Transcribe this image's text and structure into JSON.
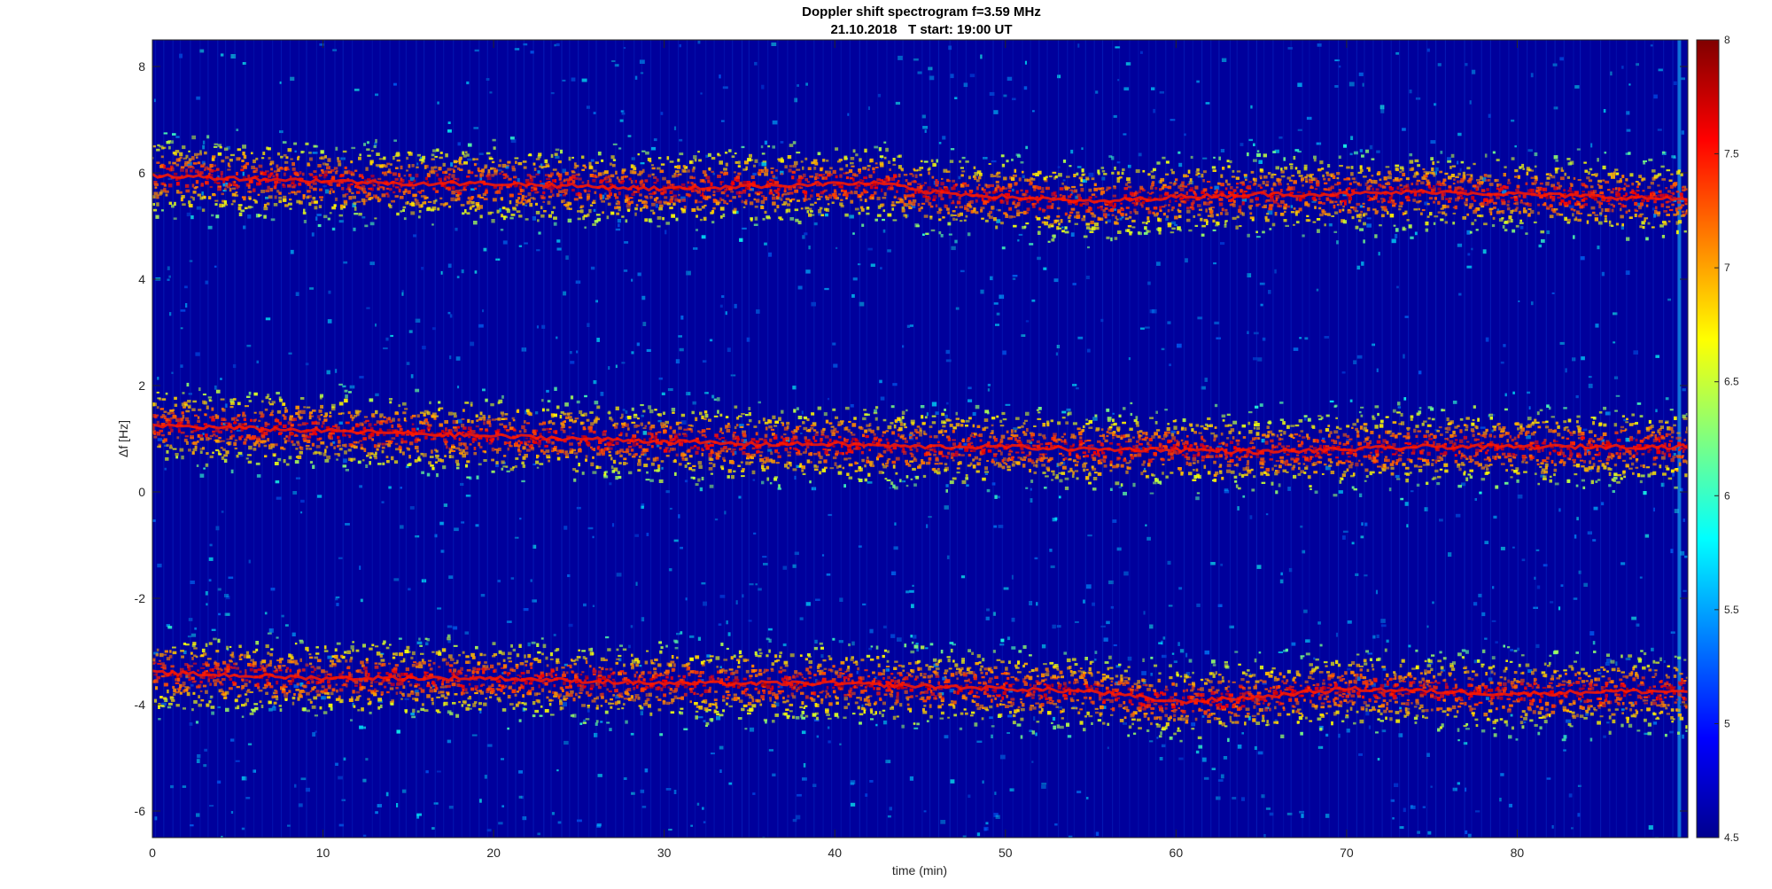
{
  "chart_data": {
    "type": "heatmap",
    "title": "Doppler shift spectrogram f=3.59 MHz",
    "subtitle": "21.10.2018   T start: 19:00 UT",
    "xlabel": "time (min)",
    "ylabel": "Δf [Hz]",
    "xlim": [
      0,
      90
    ],
    "ylim": [
      -6.5,
      8.5
    ],
    "xticks": [
      0,
      10,
      20,
      30,
      40,
      50,
      60,
      70,
      80
    ],
    "yticks": [
      -6,
      -4,
      -2,
      0,
      2,
      4,
      6,
      8
    ],
    "colorbar": {
      "colormap": "jet",
      "range": [
        4.5,
        8
      ],
      "ticks": [
        "4.5",
        "5",
        "5.5",
        "6",
        "6.5",
        "7",
        "7.5",
        "8"
      ]
    },
    "grid": false,
    "series": [
      {
        "x": [
          0,
          5,
          10,
          15,
          20,
          25,
          30,
          35,
          40,
          43,
          45,
          50,
          55,
          60,
          65,
          70,
          75,
          80,
          85,
          90
        ],
        "y": [
          5.95,
          5.9,
          5.85,
          5.8,
          5.8,
          5.75,
          5.7,
          5.75,
          5.8,
          5.8,
          5.65,
          5.55,
          5.45,
          5.55,
          5.6,
          5.6,
          5.65,
          5.6,
          5.55,
          5.5
        ]
      },
      {
        "x": [
          0,
          5,
          10,
          15,
          20,
          25,
          30,
          35,
          40,
          45,
          50,
          55,
          60,
          65,
          70,
          75,
          80,
          85,
          90
        ],
        "y": [
          1.25,
          1.2,
          1.15,
          1.1,
          1.05,
          1.0,
          0.95,
          0.9,
          0.9,
          0.85,
          0.85,
          0.8,
          0.8,
          0.75,
          0.8,
          0.85,
          0.85,
          0.85,
          0.85
        ]
      },
      {
        "x": [
          0,
          5,
          10,
          15,
          20,
          25,
          30,
          35,
          40,
          45,
          50,
          55,
          60,
          65,
          70,
          75,
          80,
          85,
          90
        ],
        "y": [
          -3.4,
          -3.45,
          -3.5,
          -3.5,
          -3.5,
          -3.55,
          -3.6,
          -3.6,
          -3.6,
          -3.65,
          -3.7,
          -3.75,
          -3.95,
          -3.85,
          -3.7,
          -3.75,
          -3.8,
          -3.75,
          -3.75
        ]
      }
    ]
  }
}
